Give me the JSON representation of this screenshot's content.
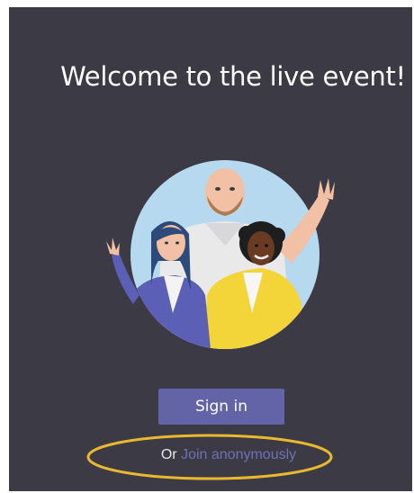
{
  "welcome": {
    "title": "Welcome to the live event!"
  },
  "illustration": {
    "icon": "people-celebrating-illustration"
  },
  "signin": {
    "label": "Sign in"
  },
  "anonymous": {
    "prefix": "Or",
    "link_label": "Join anonymously"
  },
  "colors": {
    "background": "#3b3a45",
    "accent": "#6264a7",
    "link": "#6f71b4",
    "highlight": "#e8b92e"
  }
}
